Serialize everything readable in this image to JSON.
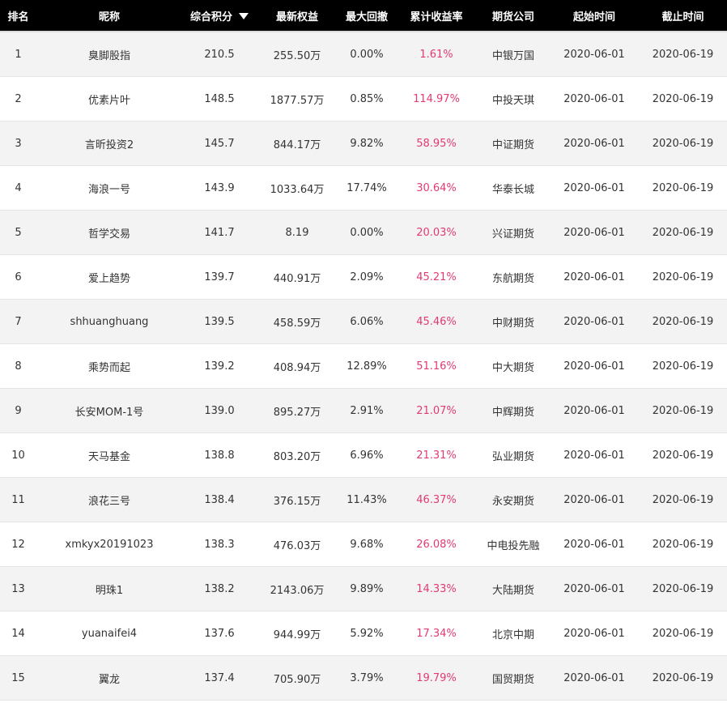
{
  "header": {
    "rank": "排名",
    "nickname": "昵称",
    "score": "综合积分",
    "equity": "最新权益",
    "drawdown": "最大回撤",
    "return": "累计收益率",
    "broker": "期货公司",
    "start": "起始时间",
    "end": "截止时间",
    "sort_icon": "sort-desc-icon"
  },
  "colors": {
    "header_bg": "#000000",
    "return_text": "#e23a73",
    "zebra": "#f3f3f3"
  },
  "rows": [
    {
      "rank": "1",
      "nickname": "臭脚股指",
      "score": "210.5",
      "equity": "255.50万",
      "drawdown": "0.00%",
      "return": "1.61%",
      "broker": "中银万国",
      "start": "2020-06-01",
      "end": "2020-06-19"
    },
    {
      "rank": "2",
      "nickname": "优素片叶",
      "score": "148.5",
      "equity": "1877.57万",
      "drawdown": "0.85%",
      "return": "114.97%",
      "broker": "中投天琪",
      "start": "2020-06-01",
      "end": "2020-06-19"
    },
    {
      "rank": "3",
      "nickname": "言昕投资2",
      "score": "145.7",
      "equity": "844.17万",
      "drawdown": "9.82%",
      "return": "58.95%",
      "broker": "中证期货",
      "start": "2020-06-01",
      "end": "2020-06-19"
    },
    {
      "rank": "4",
      "nickname": "海浪一号",
      "score": "143.9",
      "equity": "1033.64万",
      "drawdown": "17.74%",
      "return": "30.64%",
      "broker": "华泰长城",
      "start": "2020-06-01",
      "end": "2020-06-19"
    },
    {
      "rank": "5",
      "nickname": "哲学交易",
      "score": "141.7",
      "equity": "8.19",
      "drawdown": "0.00%",
      "return": "20.03%",
      "broker": "兴证期货",
      "start": "2020-06-01",
      "end": "2020-06-19"
    },
    {
      "rank": "6",
      "nickname": "爱上趋势",
      "score": "139.7",
      "equity": "440.91万",
      "drawdown": "2.09%",
      "return": "45.21%",
      "broker": "东航期货",
      "start": "2020-06-01",
      "end": "2020-06-19"
    },
    {
      "rank": "7",
      "nickname": "shhuanghuang",
      "score": "139.5",
      "equity": "458.59万",
      "drawdown": "6.06%",
      "return": "45.46%",
      "broker": "中财期货",
      "start": "2020-06-01",
      "end": "2020-06-19"
    },
    {
      "rank": "8",
      "nickname": "乘势而起",
      "score": "139.2",
      "equity": "408.94万",
      "drawdown": "12.89%",
      "return": "51.16%",
      "broker": "中大期货",
      "start": "2020-06-01",
      "end": "2020-06-19"
    },
    {
      "rank": "9",
      "nickname": "长安MOM-1号",
      "score": "139.0",
      "equity": "895.27万",
      "drawdown": "2.91%",
      "return": "21.07%",
      "broker": "中辉期货",
      "start": "2020-06-01",
      "end": "2020-06-19"
    },
    {
      "rank": "10",
      "nickname": "天马基金",
      "score": "138.8",
      "equity": "803.20万",
      "drawdown": "6.96%",
      "return": "21.31%",
      "broker": "弘业期货",
      "start": "2020-06-01",
      "end": "2020-06-19"
    },
    {
      "rank": "11",
      "nickname": "浪花三号",
      "score": "138.4",
      "equity": "376.15万",
      "drawdown": "11.43%",
      "return": "46.37%",
      "broker": "永安期货",
      "start": "2020-06-01",
      "end": "2020-06-19"
    },
    {
      "rank": "12",
      "nickname": "xmkyx20191023",
      "score": "138.3",
      "equity": "476.03万",
      "drawdown": "9.68%",
      "return": "26.08%",
      "broker": "中电投先融",
      "start": "2020-06-01",
      "end": "2020-06-19"
    },
    {
      "rank": "13",
      "nickname": "明珠1",
      "score": "138.2",
      "equity": "2143.06万",
      "drawdown": "9.89%",
      "return": "14.33%",
      "broker": "大陆期货",
      "start": "2020-06-01",
      "end": "2020-06-19"
    },
    {
      "rank": "14",
      "nickname": "yuanaifei4",
      "score": "137.6",
      "equity": "944.99万",
      "drawdown": "5.92%",
      "return": "17.34%",
      "broker": "北京中期",
      "start": "2020-06-01",
      "end": "2020-06-19"
    },
    {
      "rank": "15",
      "nickname": "翼龙",
      "score": "137.4",
      "equity": "705.90万",
      "drawdown": "3.79%",
      "return": "19.79%",
      "broker": "国贸期货",
      "start": "2020-06-01",
      "end": "2020-06-19"
    }
  ]
}
